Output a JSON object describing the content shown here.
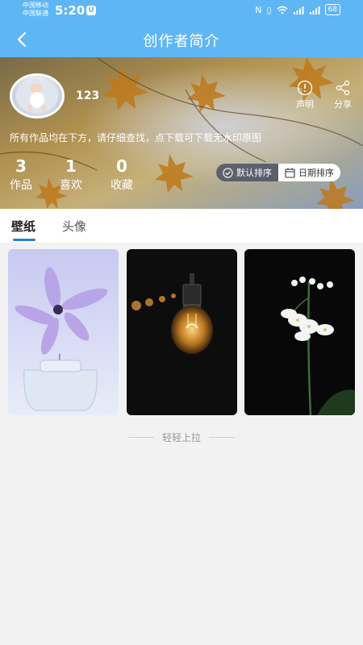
{
  "status_bar": {
    "carrier_1": "中国移动",
    "carrier_2": "中国联通",
    "time": "5:20",
    "battery": "68"
  },
  "nav": {
    "title": "创作者简介"
  },
  "profile": {
    "username": "123",
    "notice": "所有作品均在下方，请仔细查找，点下载可下载无水印原图",
    "actions": [
      {
        "label": "声明",
        "icon": "info-icon"
      },
      {
        "label": "分享",
        "icon": "share-icon"
      }
    ],
    "stats": [
      {
        "value": "3",
        "label": "作品"
      },
      {
        "value": "1",
        "label": "喜欢"
      },
      {
        "value": "0",
        "label": "收藏"
      }
    ],
    "sort": {
      "default_label": "默认排序",
      "date_label": "日期排序"
    }
  },
  "tabs": [
    {
      "label": "壁纸",
      "active": true
    },
    {
      "label": "头像",
      "active": false
    }
  ],
  "gallery": {
    "items": [
      {
        "name": "flower-in-vase-wallpaper"
      },
      {
        "name": "light-bulb-wallpaper"
      },
      {
        "name": "white-flowers-wallpaper"
      }
    ]
  },
  "footer": {
    "pull_hint": "轻轻上拉"
  },
  "colors": {
    "primary": "#5fb6f5",
    "tab_indicator": "#2a7fd4"
  }
}
